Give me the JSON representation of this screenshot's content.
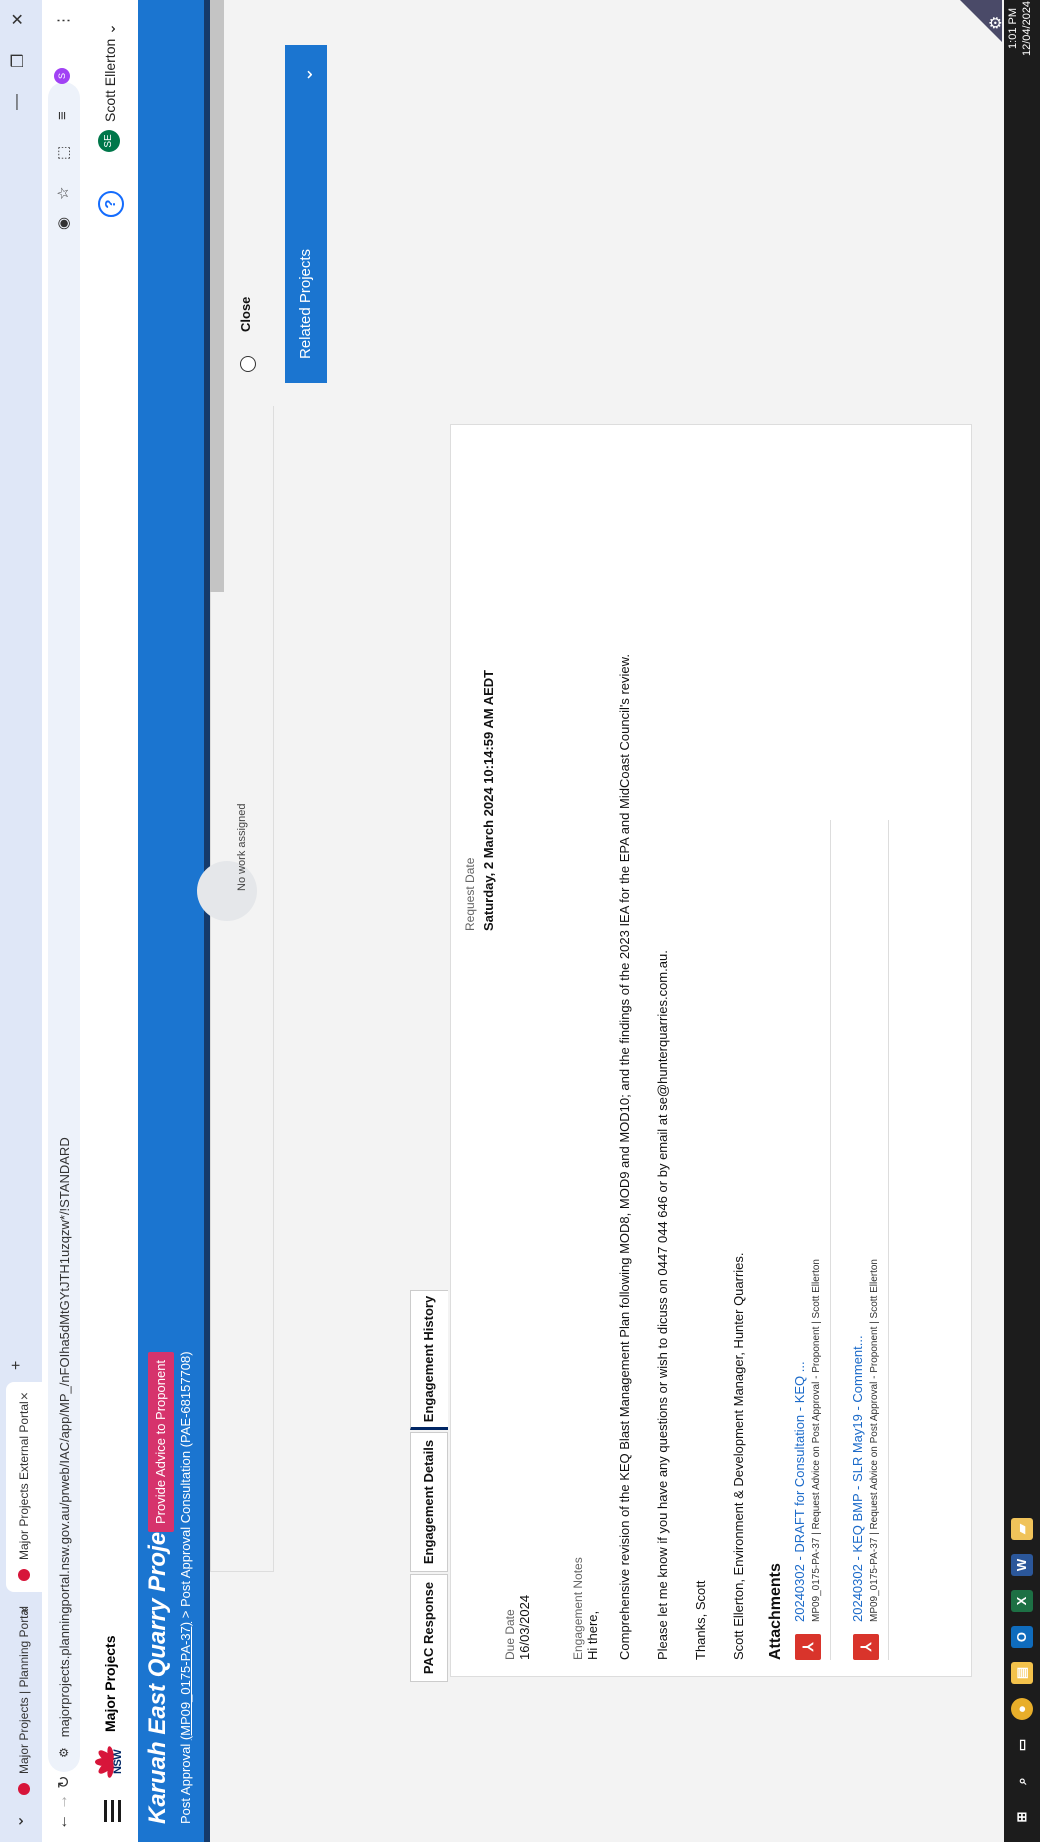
{
  "browser": {
    "tabs": [
      {
        "title": "Major Projects | Planning Portal",
        "active": false
      },
      {
        "title": "Major Projects External Portal",
        "active": true
      }
    ],
    "new_tab": "+",
    "url": "majorprojects.planningportal.nsw.gov.au/prweb/IAC/app/MP_/nFOIha5dMtGYtJTH1uzqzw*/!STANDARD",
    "profile_initial": "S"
  },
  "header": {
    "nsw_logo_text": "NSW",
    "app_title": "Major Projects",
    "help_glyph": "?",
    "user_initials": "SE",
    "user_name": "Scott Ellerton"
  },
  "banner": {
    "project_title": "Karuah East Quarry Project",
    "status_pill": "Provide Advice to Proponent",
    "crumb_root": "Post Approval",
    "crumb_app_link": "(MP09_0175-PA-37)",
    "crumb_sep": ">",
    "crumb_current": "Post Approval Consultation",
    "crumb_case": "(PAE-68157708)"
  },
  "worklist": {
    "empty_text": "No work assigned"
  },
  "side": {
    "close_label": "Close",
    "related_projects": "Related Projects"
  },
  "tabs": [
    "PAC Response",
    "Engagement Details",
    "Engagement History"
  ],
  "engagement": {
    "due_date_label": "Due Date",
    "due_date": "16/03/2024",
    "request_date_label": "Request Date",
    "request_date": "Saturday, 2 March 2024 10:14:59 AM AEDT",
    "notes_label": "Engagement Notes",
    "greeting": "Hi there,",
    "para1": "Comprehensive revision of the KEQ Blast Management Plan following MOD8, MOD9 and MOD10; and the findings of the 2023 IEA for the EPA and MidCoast Council's review.",
    "para2": "Please let me know if you have any questions or wish to dicuss on 0447 044 646 or by email at se@hunterquarries.com.au.",
    "para3": "Thanks, Scott",
    "signature": "Scott Ellerton, Environment & Development Manager, Hunter Quarries."
  },
  "attachments": {
    "heading": "Attachments",
    "items": [
      {
        "name": "20240302 - DRAFT for Consultation - KEQ ...",
        "meta": "MP09_0175-PA-37 | Request Advice on Post Approval - Proponent | Scott Ellerton"
      },
      {
        "name": "20240302 - KEQ BMP - SLR May19 - Comment...",
        "meta": "MP09_0175-PA-37 | Request Advice on Post Approval - Proponent | Scott Ellerton"
      }
    ]
  },
  "taskbar": {
    "time": "1:01 PM",
    "date": "12/04/2024"
  },
  "colors": {
    "banner_blue": "#1b75d0",
    "pill_pink": "#d6336c",
    "navy": "#002664",
    "pdf_red": "#d9342b"
  }
}
